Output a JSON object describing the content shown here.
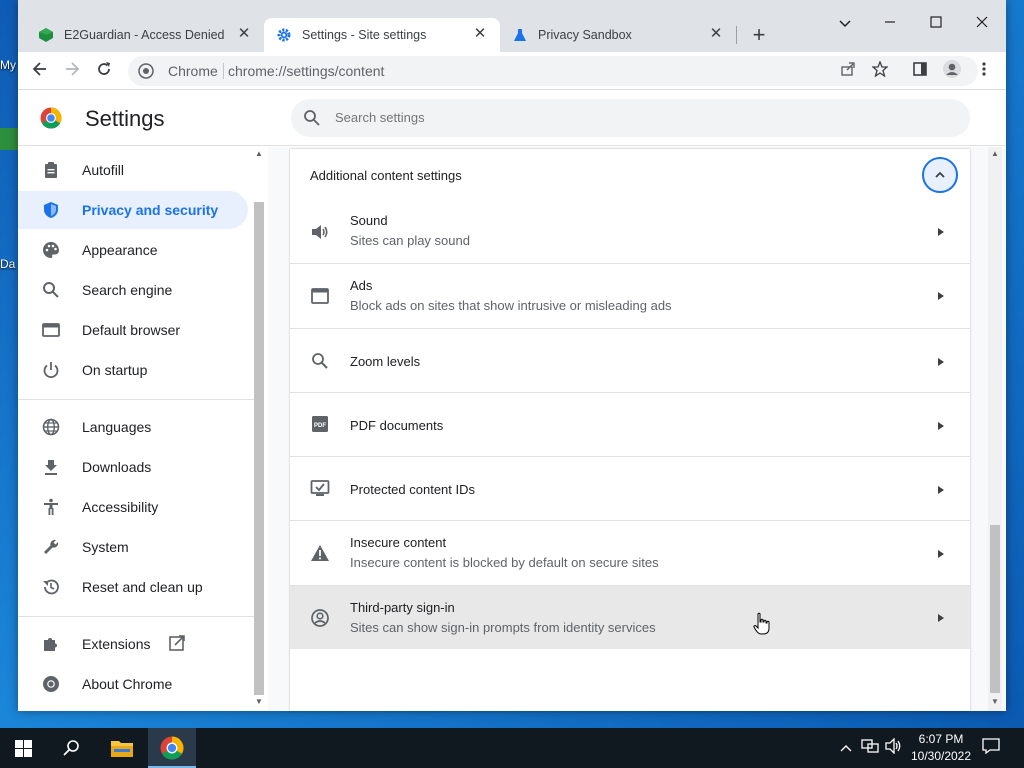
{
  "desktop": {
    "icon_labels": [
      "My",
      "Da"
    ]
  },
  "tabs": [
    {
      "title": "E2Guardian - Access Denied",
      "active": false
    },
    {
      "title": "Settings - Site settings",
      "active": true
    },
    {
      "title": "Privacy Sandbox",
      "active": false
    }
  ],
  "omnibox": {
    "site_label": "Chrome",
    "url": "chrome://settings/content"
  },
  "header": {
    "title": "Settings",
    "search_placeholder": "Search settings"
  },
  "sidebar": {
    "items": [
      {
        "label": "Autofill",
        "icon": "clipboard-icon",
        "active": false
      },
      {
        "label": "Privacy and security",
        "icon": "shield-icon",
        "active": true
      },
      {
        "label": "Appearance",
        "icon": "palette-icon",
        "active": false
      },
      {
        "label": "Search engine",
        "icon": "search-icon",
        "active": false
      },
      {
        "label": "Default browser",
        "icon": "browser-icon",
        "active": false
      },
      {
        "label": "On startup",
        "icon": "power-icon",
        "active": false
      },
      {
        "label": "Languages",
        "icon": "globe-icon",
        "active": false
      },
      {
        "label": "Downloads",
        "icon": "download-icon",
        "active": false
      },
      {
        "label": "Accessibility",
        "icon": "accessibility-icon",
        "active": false
      },
      {
        "label": "System",
        "icon": "wrench-icon",
        "active": false
      },
      {
        "label": "Reset and clean up",
        "icon": "history-icon",
        "active": false
      },
      {
        "label": "Extensions",
        "icon": "puzzle-icon",
        "active": false
      },
      {
        "label": "About Chrome",
        "icon": "chrome-icon",
        "active": false
      }
    ]
  },
  "content": {
    "section_title": "Additional content settings",
    "rows": [
      {
        "title": "Sound",
        "subtitle": "Sites can play sound",
        "icon": "speaker-icon"
      },
      {
        "title": "Ads",
        "subtitle": "Block ads on sites that show intrusive or misleading ads",
        "icon": "ads-icon"
      },
      {
        "title": "Zoom levels",
        "subtitle": "",
        "icon": "zoom-icon"
      },
      {
        "title": "PDF documents",
        "subtitle": "",
        "icon": "pdf-icon"
      },
      {
        "title": "Protected content IDs",
        "subtitle": "",
        "icon": "protected-content-icon"
      },
      {
        "title": "Insecure content",
        "subtitle": "Insecure content is blocked by default on secure sites",
        "icon": "warning-icon"
      },
      {
        "title": "Third-party sign-in",
        "subtitle": "Sites can show sign-in prompts from identity services",
        "icon": "account-icon",
        "hovered": true
      }
    ]
  },
  "taskbar": {
    "time": "6:07 PM",
    "date": "10/30/2022"
  },
  "colors": {
    "accent": "#1a73e8",
    "active_nav_bg": "#e8f0fe",
    "taskbar": "#101820"
  }
}
